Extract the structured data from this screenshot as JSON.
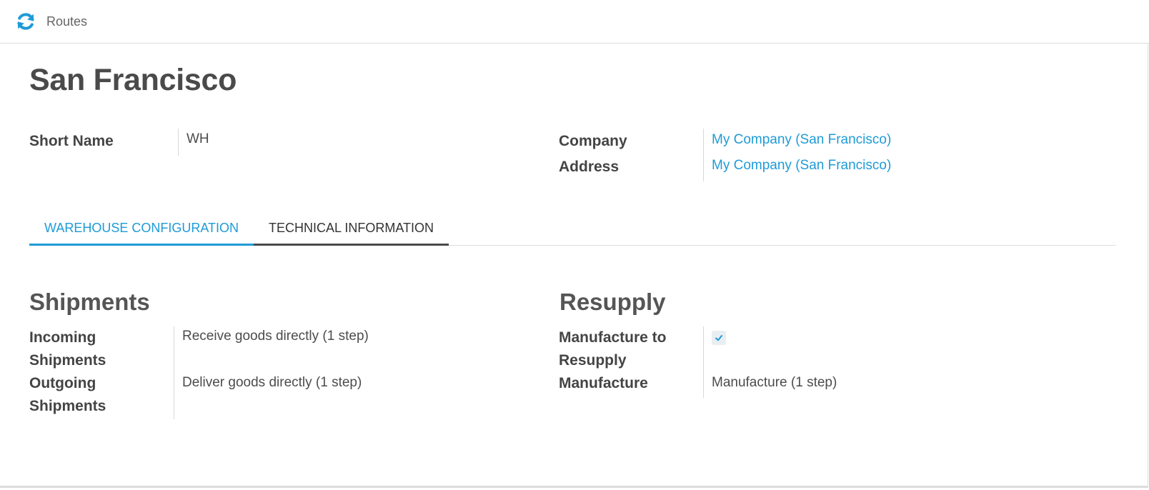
{
  "topbar": {
    "routes_button": {
      "icon": "refresh-icon",
      "label": "Routes"
    }
  },
  "record": {
    "title": "San Francisco",
    "short_name_label": "Short Name",
    "short_name_value": "WH",
    "company_label": "Company",
    "company_value": "My Company (San Francisco)",
    "address_label": "Address",
    "address_value": "My Company (San Francisco)"
  },
  "tabs": [
    {
      "label": "WAREHOUSE CONFIGURATION",
      "active": true
    },
    {
      "label": "TECHNICAL INFORMATION",
      "active": false
    }
  ],
  "shipments": {
    "title": "Shipments",
    "incoming_label": "Incoming Shipments",
    "incoming_value": "Receive goods directly (1 step)",
    "outgoing_label": "Outgoing Shipments",
    "outgoing_value": "Deliver goods directly (1 step)"
  },
  "resupply": {
    "title": "Resupply",
    "manufacture_to_resupply_label": "Manufacture to Resupply",
    "manufacture_to_resupply_checked": true,
    "manufacture_label": "Manufacture",
    "manufacture_value": "Manufacture (1 step)"
  },
  "colors": {
    "accent": "#1e9bd7",
    "text": "#4c4c4c"
  }
}
